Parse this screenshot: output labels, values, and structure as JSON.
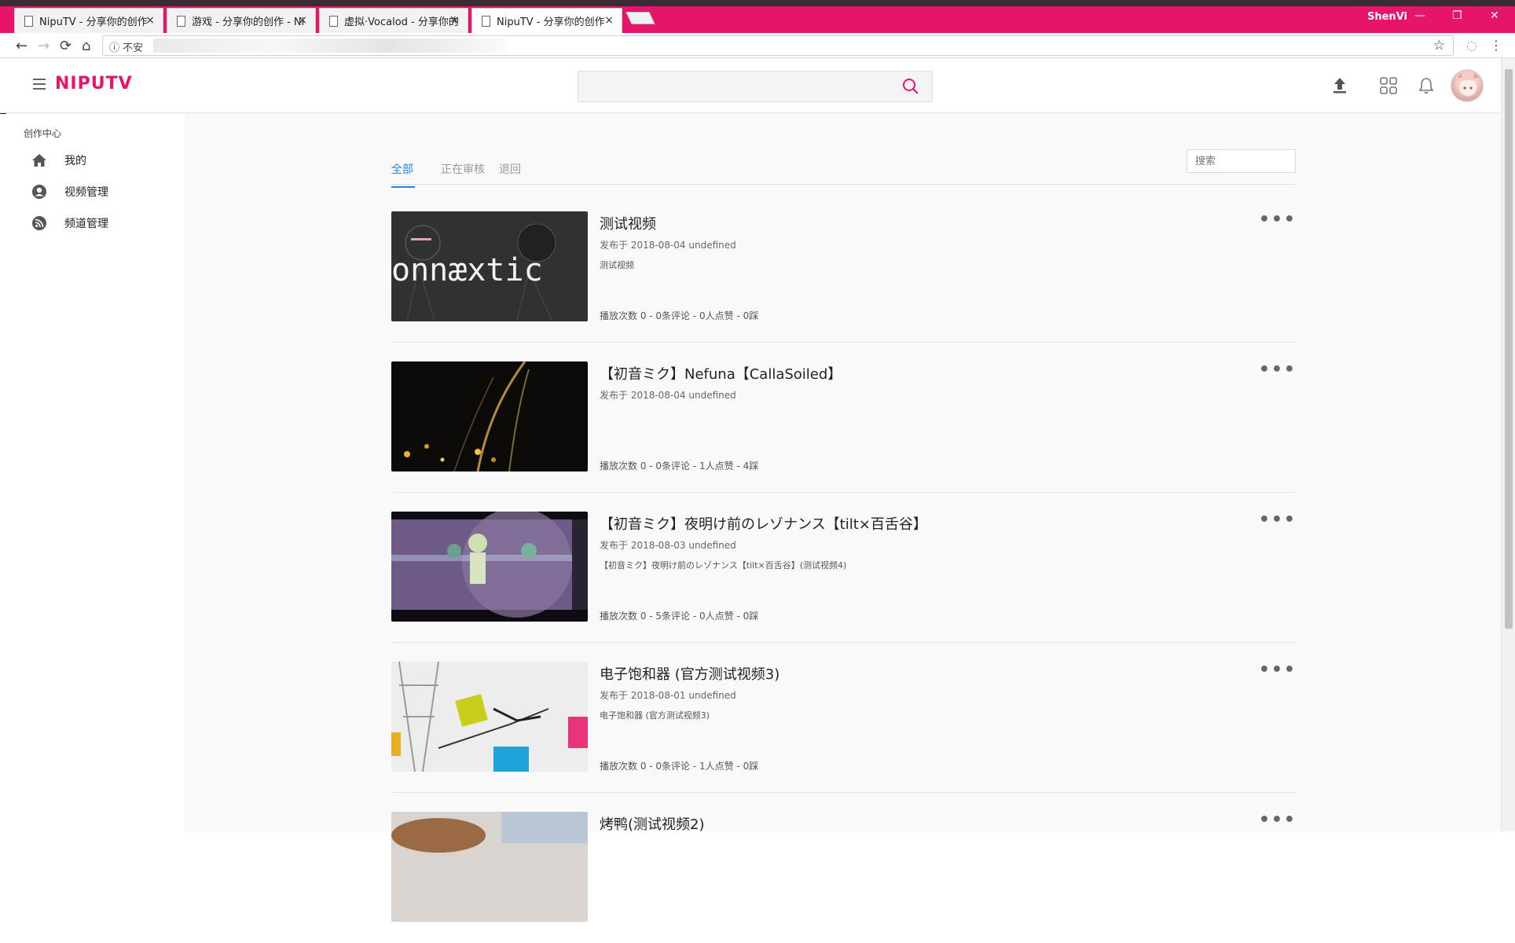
{
  "browser": {
    "tabs": [
      {
        "label": "NipuTV - 分享你的创作",
        "active": false
      },
      {
        "label": "游戏 - 分享你的创作 - Ni",
        "active": false
      },
      {
        "label": "虚拟·Vocalod - 分享你的",
        "active": false
      },
      {
        "label": "NipuTV - 分享你的创作",
        "active": true
      }
    ],
    "tab_close": "×",
    "user": "ShenVi",
    "url_prefix": "ⓘ 不安",
    "window_controls": {
      "minimize": "—",
      "restore": "❐",
      "close": "✕"
    }
  },
  "header": {
    "logo": "NIPUTV",
    "search_placeholder": "",
    "accent_color": "#e6146b"
  },
  "sidebar": {
    "section_title": "创作中心",
    "items": [
      {
        "label": "我的",
        "icon": "home-icon"
      },
      {
        "label": "视频管理",
        "icon": "user-circle-icon"
      },
      {
        "label": "频道管理",
        "icon": "rss-icon"
      }
    ]
  },
  "filters": {
    "tabs": [
      "全部",
      "正在审核",
      "退回"
    ],
    "active_index": 0,
    "search_placeholder": "搜索"
  },
  "videos": [
    {
      "title": "测试视频",
      "date": "发布于 2018-08-04 undefined",
      "description": "测试视频",
      "stats": "播放次数 0 - 0条评论 - 0人点赞 - 0踩",
      "thumb_caption": "onnæxtic"
    },
    {
      "title": "【初音ミク】Nefuna【CallaSoiled】",
      "date": "发布于 2018-08-04 undefined",
      "description": "",
      "stats": "播放次数 0 - 0条评论 - 1人点赞 - 4踩"
    },
    {
      "title": "【初音ミク】夜明け前のレゾナンス【tilt×百舌谷】",
      "date": "发布于 2018-08-03 undefined",
      "description": "【初音ミク】夜明け前のレゾナンス【tilt×百舌谷】(测试视频4)",
      "stats": "播放次数 0 - 5条评论 - 0人点赞 - 0踩"
    },
    {
      "title": "电子饱和器 (官方测试视频3)",
      "date": "发布于 2018-08-01 undefined",
      "description": "电子饱和器 (官方测试视频3)",
      "stats": "播放次数 0 - 0条评论 - 1人点赞 - 0踩"
    },
    {
      "title": "烤鸭(测试视频2)",
      "date": "",
      "description": "",
      "stats": ""
    }
  ],
  "more_label": "•••"
}
